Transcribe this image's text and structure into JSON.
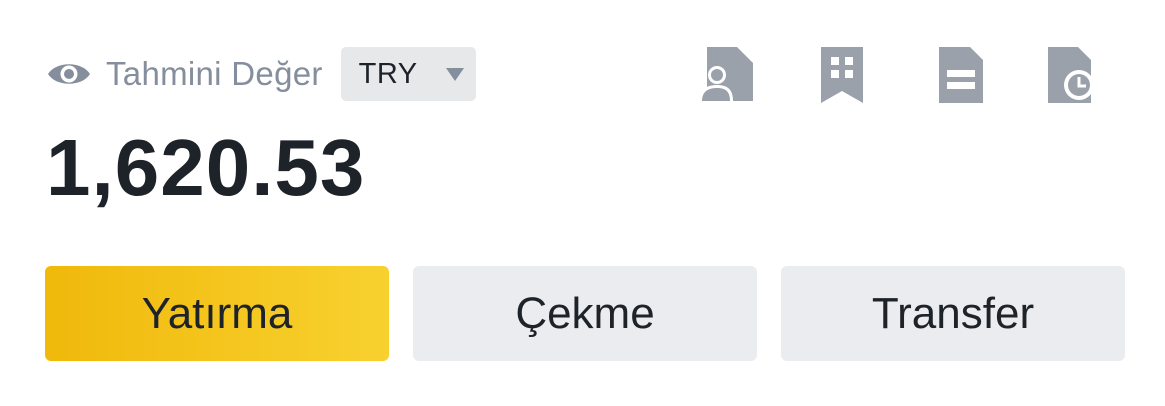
{
  "balance_header": {
    "label": "Tahmini Değer",
    "currency": "TRY",
    "visibility_icon": "eye-icon"
  },
  "toolbar_icons": [
    "user-document-icon",
    "building-bookmark-icon",
    "document-icon",
    "document-history-icon"
  ],
  "balance": {
    "value": "1,620.53"
  },
  "actions": {
    "deposit_label": "Yatırma",
    "withdraw_label": "Çekme",
    "transfer_label": "Transfer"
  },
  "colors": {
    "primary_accent": "#f0b90b",
    "primary_accent_end": "#f8d12f",
    "secondary_button": "#eaecef",
    "icon_gray": "#9aa1ab",
    "text_dark": "#1e2329",
    "text_muted": "#848e9c"
  }
}
